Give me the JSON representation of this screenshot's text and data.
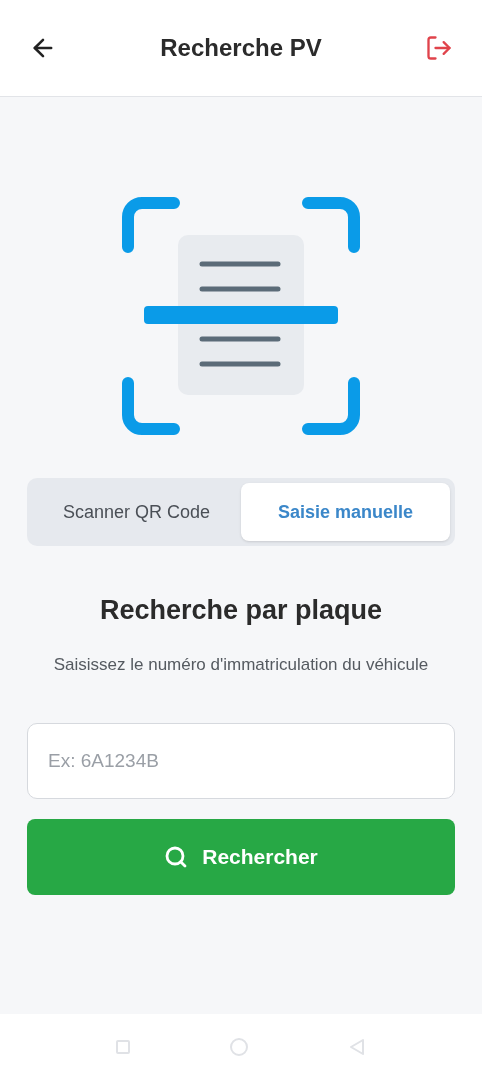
{
  "header": {
    "title": "Recherche PV"
  },
  "tabs": [
    {
      "label": "Scanner QR Code",
      "selected": false
    },
    {
      "label": "Saisie manuelle",
      "selected": true
    }
  ],
  "heading": "Recherche par plaque",
  "subtitle": "Saisissez le numéro d'immatriculation du véhicule",
  "plate_field": {
    "placeholder": "Ex: 6A1234B"
  },
  "search_button": {
    "label": "Rechercher"
  }
}
